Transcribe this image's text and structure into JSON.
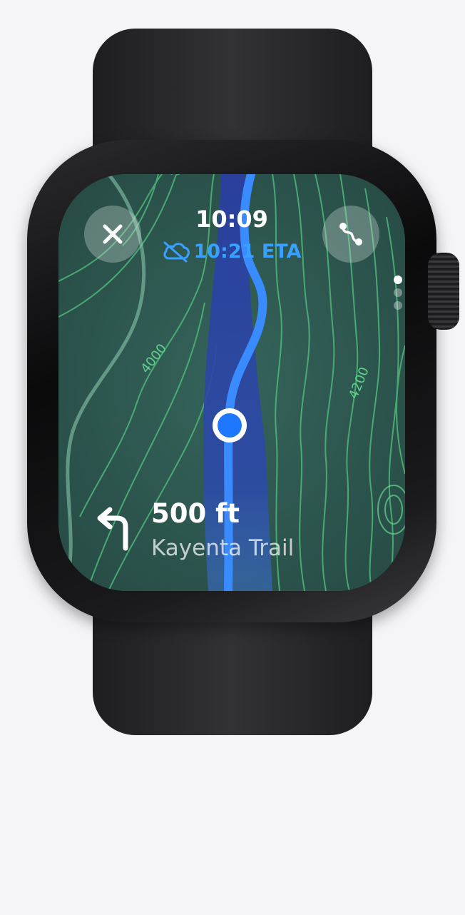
{
  "status": {
    "time": "10:09",
    "eta": "10:21 ETA",
    "eta_icon": "cloud-offline-icon"
  },
  "controls": {
    "close_icon": "close-icon",
    "route_icon": "route-icon",
    "pages": {
      "count": 3,
      "active": 0
    }
  },
  "map": {
    "contour_labels": [
      "4000",
      "4200"
    ],
    "colors": {
      "terrain": "#2f5a52",
      "contour": "#5fd08a",
      "route": "#3a8bff",
      "route_band": "#2a3fa0"
    }
  },
  "navigation": {
    "turn_icon": "turn-left-arrow-icon",
    "distance": "500 ft",
    "street": "Kayenta Trail"
  }
}
